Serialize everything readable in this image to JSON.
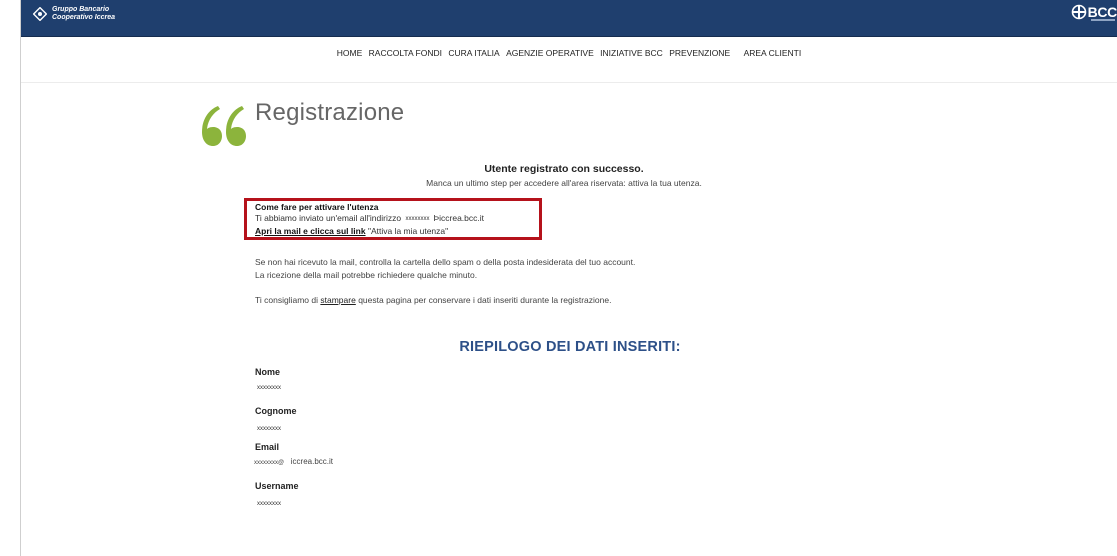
{
  "header": {
    "brand_line1": "Gruppo Bancario",
    "brand_line2": "Cooperativo Iccrea",
    "right_logo_text": "BCC",
    "colors": {
      "bar": "#1f3f6e",
      "accent": "#8cb43c",
      "highlight": "#b5121b",
      "summary": "#2d5088"
    }
  },
  "nav": {
    "items": [
      "HOME",
      "RACCOLTA FONDI",
      "CURA ITALIA",
      "AGENZIE OPERATIVE",
      "INIZIATIVE BCC",
      "PREVENZIONE",
      "AREA CLIENTI"
    ]
  },
  "page": {
    "title": "Registrazione",
    "success_title": "Utente registrato con successo.",
    "success_sub": "Manca un ultimo step per accedere all'area riservata: attiva la tua utenza.",
    "activate": {
      "heading": "Come fare per attivare l'utenza",
      "line1_prefix": "Ti abbiamo inviato un'email all'indirizzo",
      "line1_masked": "xxxxxxxx",
      "line1_suffix": "Þiccrea.bcc.it",
      "line2_bold": "Apri la mail e clicca sul link",
      "line2_rest": "\"Attiva la mia utenza\""
    },
    "note_line1": "Se non hai ricevuto la mail, controlla la cartella dello spam o della posta indesiderata del tuo account.",
    "note_line2": "La ricezione della mail potrebbe richiedere qualche minuto.",
    "tip_prefix": "Ti consigliamo di",
    "tip_link": "stampare",
    "tip_suffix": "questa pagina per conservare i dati inseriti durante la registrazione.",
    "summary_title": "RIEPILOGO DEI DATI INSERITI:"
  },
  "fields": {
    "nome_label": "Nome",
    "nome_value": "xxxxxxxx",
    "cognome_label": "Cognome",
    "cognome_value": "xxxxxxxx",
    "email_label": "Email",
    "email_value_masked": "xxxxxxxx@",
    "email_value_domain": "iccrea.bcc.it",
    "username_label": "Username",
    "username_value": "xxxxxxxx"
  }
}
